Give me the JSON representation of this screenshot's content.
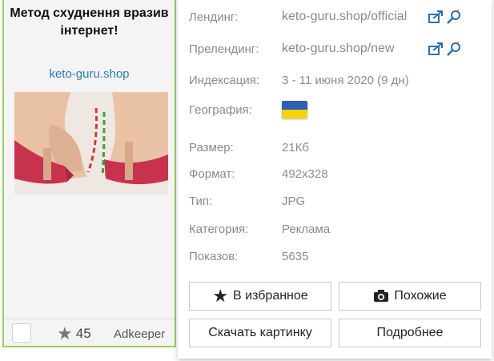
{
  "ad": {
    "title": "Метод схуднення вразив інтернет!",
    "domain": "keto-guru.shop",
    "star_count": "45",
    "network": "Adkeeper"
  },
  "details": {
    "landing_label": "Лендинг:",
    "landing_value": "keto-guru.shop/official",
    "prelanding_label": "Прелендинг:",
    "prelanding_value": "keto-guru.shop/new",
    "indexing_label": "Индексация:",
    "indexing_value": "3 - 11 июня 2020 (9 дн)",
    "geo_label": "География:",
    "geo_flag": "ukraine-flag",
    "size_label": "Размер:",
    "size_value": "21Кб",
    "format_label": "Формат:",
    "format_value": "492x328",
    "type_label": "Тип:",
    "type_value": "JPG",
    "category_label": "Категория:",
    "category_value": "Реклама",
    "impressions_label": "Показов:",
    "impressions_value": "5635"
  },
  "buttons": {
    "favorites": "В избранное",
    "similar": "Похожие",
    "download": "Скачать картинку",
    "more": "Подробнее"
  },
  "colors": {
    "card_border": "#9ccc65",
    "link": "#2a7ab8",
    "icon_blue": "#2a6fb0",
    "muted_text": "#8a8a8a"
  }
}
